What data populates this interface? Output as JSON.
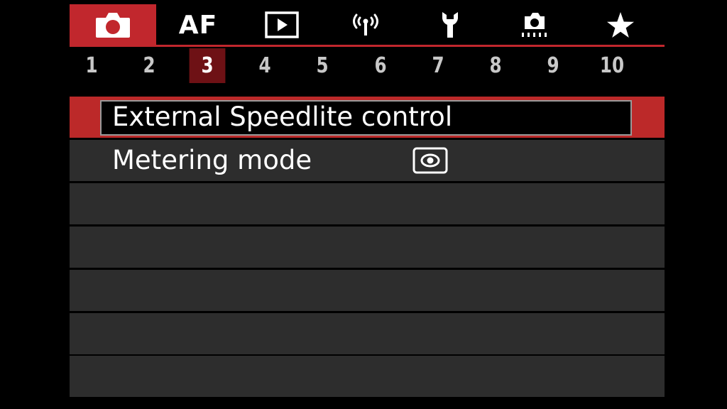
{
  "tabs": [
    {
      "id": "shooting",
      "icon": "camera-icon",
      "active": true
    },
    {
      "id": "af",
      "label": "AF",
      "active": false
    },
    {
      "id": "playback",
      "icon": "playback-icon",
      "active": false
    },
    {
      "id": "wireless",
      "icon": "wireless-icon",
      "active": false
    },
    {
      "id": "setup",
      "icon": "wrench-icon",
      "active": false
    },
    {
      "id": "custom",
      "icon": "custom-functions-icon",
      "active": false
    },
    {
      "id": "mymenu",
      "icon": "star-icon",
      "active": false
    }
  ],
  "pages": [
    "1",
    "2",
    "3",
    "4",
    "5",
    "6",
    "7",
    "8",
    "9",
    "10"
  ],
  "active_page": "3",
  "menu": {
    "items": [
      {
        "label": "External Speedlite control",
        "selected": true
      },
      {
        "label": "Metering mode",
        "value_icon": "evaluative-metering-icon",
        "selected": false
      },
      {
        "label": ""
      },
      {
        "label": ""
      },
      {
        "label": ""
      },
      {
        "label": ""
      },
      {
        "label": ""
      }
    ]
  },
  "colors": {
    "accent_red": "#c1272d",
    "active_page_bg": "#6e1115",
    "row_bg": "#2d2d2d",
    "background": "#000000"
  }
}
